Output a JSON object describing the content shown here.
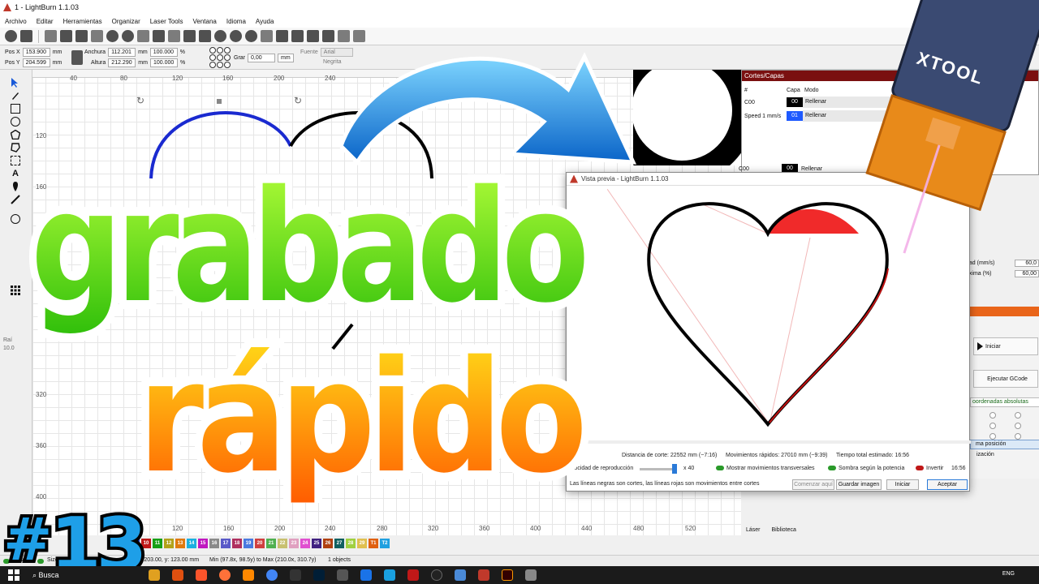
{
  "window": {
    "title": "1 - LightBurn 1.1.03"
  },
  "menu": [
    "Archivo",
    "Editar",
    "Herramientas",
    "Organizar",
    "Laser Tools",
    "Ventana",
    "Idioma",
    "Ayuda"
  ],
  "numeric": {
    "pos_x_label": "Pos X",
    "pos_x": "153.900",
    "pos_y_label": "Pos Y",
    "pos_y": "204.599",
    "unit": "mm",
    "width_label": "Anchura",
    "width": "112.201",
    "height_label": "Altura",
    "height": "212.290",
    "scale_x": "100.000",
    "scale_y": "100.000",
    "percent": "%",
    "rotate_label": "Grar",
    "rotate": "0,00",
    "font_label": "Fuente",
    "font_value": "Arial",
    "bold_label": "Negrita"
  },
  "rulers": {
    "top": [
      "40",
      "80",
      "120",
      "160",
      "200",
      "240"
    ],
    "left": [
      "120",
      "160",
      "320",
      "360",
      "400"
    ],
    "bottom": [
      "120",
      "160",
      "200",
      "240",
      "280",
      "320",
      "360",
      "400",
      "440",
      "480",
      "520"
    ]
  },
  "cuts_panel": {
    "title": "Cortes/Capas",
    "col_num": "#",
    "col_layer": "Capa",
    "col_mode": "Modo",
    "rows": [
      {
        "name": "C00",
        "badge": "00",
        "mode": "Rellenar",
        "color": "#000000"
      },
      {
        "name": "Speed 1 mm/s",
        "badge": "01",
        "mode": "Rellenar",
        "color": "#1e5aff"
      }
    ],
    "selected": {
      "name": "C00",
      "badge": "00",
      "mode": "Rellenar"
    }
  },
  "params": {
    "speed_label": "dad (mm/s)",
    "speed": "60,0",
    "power_label": "áxima (%)",
    "power": "60,00"
  },
  "laser_panel": {
    "start": "Iniciar",
    "run_gcode": "Ejecutar GCode",
    "coords": "oordenadas absolutas",
    "position": "ma posición",
    "optim": "ización"
  },
  "bottom_tabs": [
    "Láser",
    "Biblioteca"
  ],
  "palette": [
    {
      "label": "09",
      "color": "#1a3fd8"
    },
    {
      "label": "10",
      "color": "#c01818"
    },
    {
      "label": "11",
      "color": "#17a017"
    },
    {
      "label": "12",
      "color": "#b2a21a"
    },
    {
      "label": "13",
      "color": "#e07a10"
    },
    {
      "label": "14",
      "color": "#1cb0e0"
    },
    {
      "label": "15",
      "color": "#c018c0"
    },
    {
      "label": "16",
      "color": "#8a8a8a"
    },
    {
      "label": "17",
      "color": "#5a5ac8"
    },
    {
      "label": "18",
      "color": "#b03060"
    },
    {
      "label": "19",
      "color": "#4a7ae0"
    },
    {
      "label": "20",
      "color": "#d04040"
    },
    {
      "label": "21",
      "color": "#50b050"
    },
    {
      "label": "22",
      "color": "#c8c070"
    },
    {
      "label": "23",
      "color": "#e0a0c0"
    },
    {
      "label": "24",
      "color": "#e050d0"
    },
    {
      "label": "25",
      "color": "#402080"
    },
    {
      "label": "26",
      "color": "#b04010"
    },
    {
      "label": "27",
      "color": "#106060"
    },
    {
      "label": "28",
      "color": "#a0d040"
    },
    {
      "label": "29",
      "color": "#e0c050"
    },
    {
      "label": "T1",
      "color": "#e06010"
    },
    {
      "label": "T2",
      "color": "#20a0e0"
    }
  ],
  "status": {
    "move": "Move",
    "size": "Size",
    "cursor": "x: 203.00, y: 123.00 mm",
    "bounds": "Min (97.8x, 98.5y) to Max (210.0x, 310.7y)",
    "objects": "1 objects",
    "left_text_1": "Raí",
    "left_text_2": "10.0"
  },
  "preview": {
    "title": "Vista previa - LightBurn 1.1.03",
    "cut_distance": "Distancia de corte: 22552 mm (~7:16)",
    "rapid_moves": "Movimientos rápidos: 27010 mm (~9:39)",
    "total_time": "Tiempo total estimado: 16:56",
    "speed_label": "elocidad de reproducción",
    "speed_value": "x 40",
    "toggle_transversal": "Mostrar movimientos transversales",
    "toggle_shadow": "Sombra según la potencia",
    "toggle_invert": "Invertir",
    "time_current": "16:56",
    "legend": "Las líneas negras son cortes, las líneas rojas son movimientos entre cortes",
    "btn_start_here": "Comenzar aquí",
    "btn_save_image": "Guardar imagen",
    "btn_start": "Iniciar",
    "btn_accept": "Aceptar"
  },
  "overlay": {
    "title_line1": "grabado",
    "title_line2": "rápido",
    "hash": "#",
    "episode": "13",
    "brand": "XTOOL",
    "colors": {
      "green": "#5ee010",
      "orange": "#ff9a10",
      "blue": "#1e9fe8",
      "heart_blue": "#1a2ad0"
    }
  },
  "taskbar": {
    "search": "Busca",
    "lang": "ENG"
  }
}
